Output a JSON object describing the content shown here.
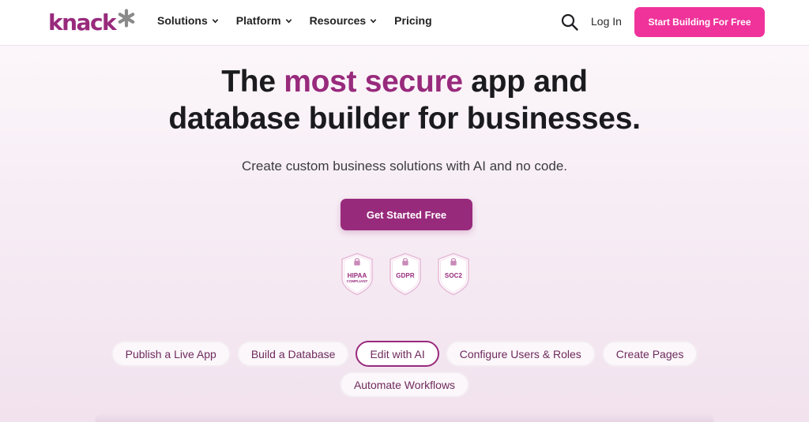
{
  "nav": {
    "logo_text": "knack",
    "menu": [
      {
        "label": "Solutions",
        "has_dropdown": true
      },
      {
        "label": "Platform",
        "has_dropdown": true
      },
      {
        "label": "Resources",
        "has_dropdown": true
      },
      {
        "label": "Pricing",
        "has_dropdown": false
      }
    ],
    "login_label": "Log In",
    "cta_label": "Start Building For Free"
  },
  "hero": {
    "headline_pre": "The ",
    "headline_accent": "most secure",
    "headline_post": " app and",
    "headline_line2": "database builder for businesses.",
    "subtitle": "Create custom business solutions with AI and no code.",
    "cta_label": "Get Started Free"
  },
  "badges": [
    {
      "label": "HIPAA",
      "sublabel": "COMPLIANT"
    },
    {
      "label": "GDPR",
      "sublabel": ""
    },
    {
      "label": "SOC2",
      "sublabel": ""
    }
  ],
  "features": {
    "row1": [
      "Publish a Live App",
      "Build a Database",
      "Edit with AI",
      "Configure Users & Roles",
      "Create Pages"
    ],
    "row2": [
      "Automate Workflows"
    ],
    "active": "Edit with AI"
  },
  "colors": {
    "brand": "#982a7c",
    "cta_pink": "#f0339b",
    "logo_star": "#8a8a8a"
  }
}
